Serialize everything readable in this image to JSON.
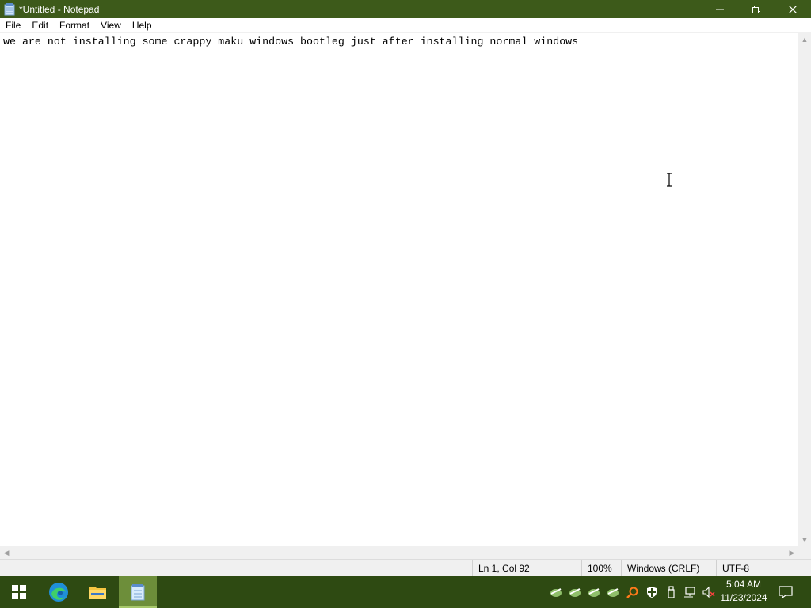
{
  "window": {
    "title": "*Untitled - Notepad",
    "minimize_glyph": "—",
    "restore_glyph": "❐",
    "close_glyph": "✕"
  },
  "menu": {
    "items": [
      "File",
      "Edit",
      "Format",
      "View",
      "Help"
    ]
  },
  "editor": {
    "content": "we are not installing some crappy maku windows bootleg just after installing normal windows"
  },
  "status": {
    "position": "Ln 1, Col 92",
    "zoom": "100%",
    "line_ending": "Windows (CRLF)",
    "encoding": "UTF-8"
  },
  "taskbar": {
    "apps": [
      {
        "name": "start",
        "icon": "windows-logo-icon"
      },
      {
        "name": "edge",
        "icon": "edge-icon"
      },
      {
        "name": "file-explorer",
        "icon": "folder-icon"
      },
      {
        "name": "notepad",
        "icon": "notepad-icon",
        "active": true
      }
    ],
    "tray_icons": [
      "app-tray-icon",
      "app-tray-icon",
      "app-tray-icon",
      "app-tray-icon",
      "search-tool-icon",
      "security-shield-icon",
      "usb-icon",
      "network-icon",
      "volume-muted-icon"
    ],
    "time": "5:04 AM",
    "date": "11/23/2024"
  },
  "colors": {
    "titlebar": "#3d5a1a",
    "taskbar": "#2e4a12",
    "active_app": "#6d8e3a"
  }
}
